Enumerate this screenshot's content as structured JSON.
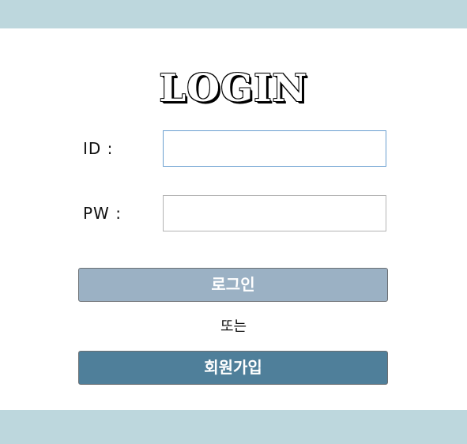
{
  "title": "LOGIN",
  "form": {
    "id_label": "ID  :",
    "id_value": "",
    "pw_label": "PW  :",
    "pw_value": ""
  },
  "buttons": {
    "login_label": "로그인",
    "or_text": "또는",
    "signup_label": "회원가입"
  },
  "colors": {
    "band": "#bdd7dd",
    "login_button": "#9bb1c4",
    "signup_button": "#4f7f9a",
    "focused_border": "#6a9fd0"
  }
}
